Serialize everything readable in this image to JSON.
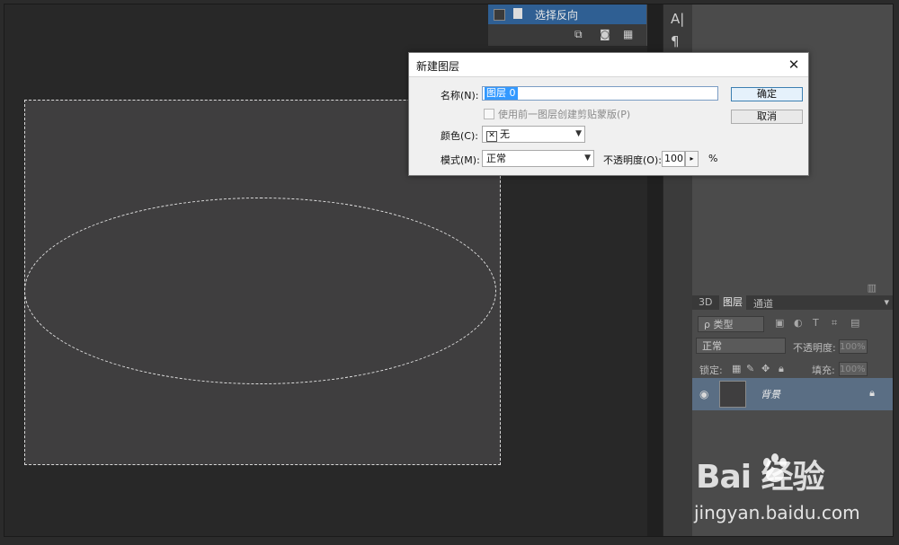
{
  "history": {
    "item_label": "选择反向"
  },
  "tool_strip": {
    "icons": [
      "text-tool-icon",
      "paragraph-icon"
    ]
  },
  "layers_panel": {
    "tabs": [
      "3D",
      "图层",
      "通道"
    ],
    "active_tab": "图层",
    "filter_label": "ρ 类型",
    "blend_mode": "正常",
    "opacity_label": "不透明度:",
    "opacity_value": "100%",
    "lock_label": "锁定:",
    "fill_label": "填充:",
    "fill_value": "100%",
    "layer_name": "背景"
  },
  "dialog": {
    "title": "新建图层",
    "name_label": "名称(N):",
    "name_value": "图层 0",
    "clip_checkbox_label": "使用前一图层创建剪贴蒙版(P)",
    "clip_checked": false,
    "color_label": "颜色(C):",
    "color_value": "无",
    "mode_label": "模式(M):",
    "mode_value": "正常",
    "opacity_label": "不透明度(O):",
    "opacity_value": "100",
    "opacity_unit": "%",
    "ok_label": "确定",
    "cancel_label": "取消"
  },
  "watermark": {
    "logo": "Bai  经验",
    "url": "jingyan.baidu.com"
  },
  "colors": {
    "canvas": "#3f3e3f",
    "selection": "#2f5f93",
    "layer_row": "#5a6e84"
  }
}
